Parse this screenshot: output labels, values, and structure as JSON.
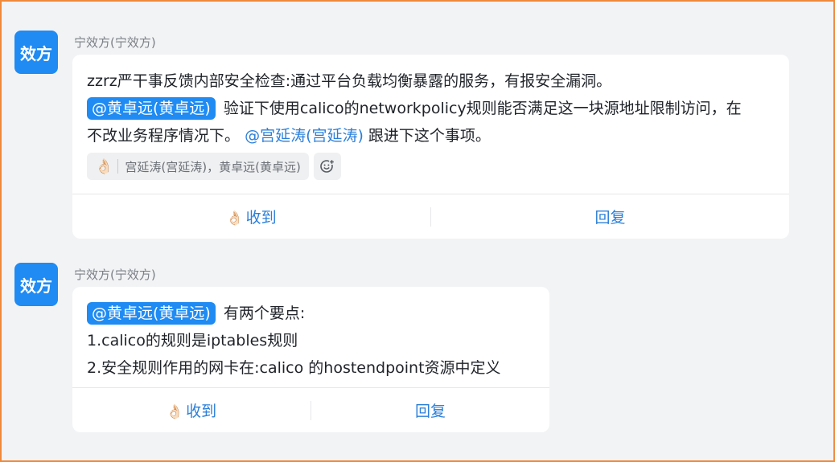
{
  "messages": [
    {
      "avatar_text": "效方",
      "sender": "宁效方(宁效方)",
      "text_before": "zzrz严干事反馈内部安全检查:通过平台负载均衡暴露的服务，有报安全漏洞。",
      "mention1": "@黄卓远(黄卓远)",
      "text_mid": "验证下使用calico的networkpolicy规则能否满足这一块源地址限制访问，在不改业务程序情况下。",
      "mention2": "@宫延涛(宫延涛)",
      "text_after": " 跟进下这个事项。",
      "reaction": {
        "emoji": "👌🏻",
        "users": "宫延涛(宫延涛)，黄卓远(黄卓远)"
      },
      "action_receive": "收到",
      "action_reply": "回复"
    },
    {
      "avatar_text": "效方",
      "sender": "宁效方(宁效方)",
      "mention": "@黄卓远(黄卓远)",
      "text_intro": "有两个要点:",
      "line1": "1.calico的规则是iptables规则",
      "line2": "2.安全规则作用的网卡在:calico 的hostendpoint资源中定义",
      "action_receive": "收到",
      "action_reply": "回复"
    }
  ],
  "icons": {
    "ok_hand": "ok-hand-icon",
    "add_reaction": "add-reaction-icon"
  },
  "colors": {
    "accent": "#1f8bf3",
    "link": "#2b7fd9",
    "frame_border": "#f0893a"
  }
}
